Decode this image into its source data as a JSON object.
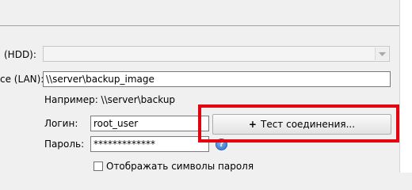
{
  "form": {
    "hdd_label": "(HDD):",
    "lan_label": "ce (LAN):",
    "lan_path_value": "\\\\server\\backup_image",
    "example_text": "Например: \\\\server\\backup",
    "login_label": "Логин:",
    "login_value": "root_user",
    "password_label": "Пароль:",
    "password_value": "*************",
    "test_button_label": "Тест соединения...",
    "test_button_icon": "+",
    "help_icon_glyph": "?",
    "show_password_label": "Отображать символы пароля",
    "show_password_checked": false
  },
  "colors": {
    "highlight_border": "#e3000f",
    "help_icon": "#2f6fc4"
  },
  "icons": [
    "chevron-down-icon",
    "plus-icon",
    "help-icon"
  ]
}
